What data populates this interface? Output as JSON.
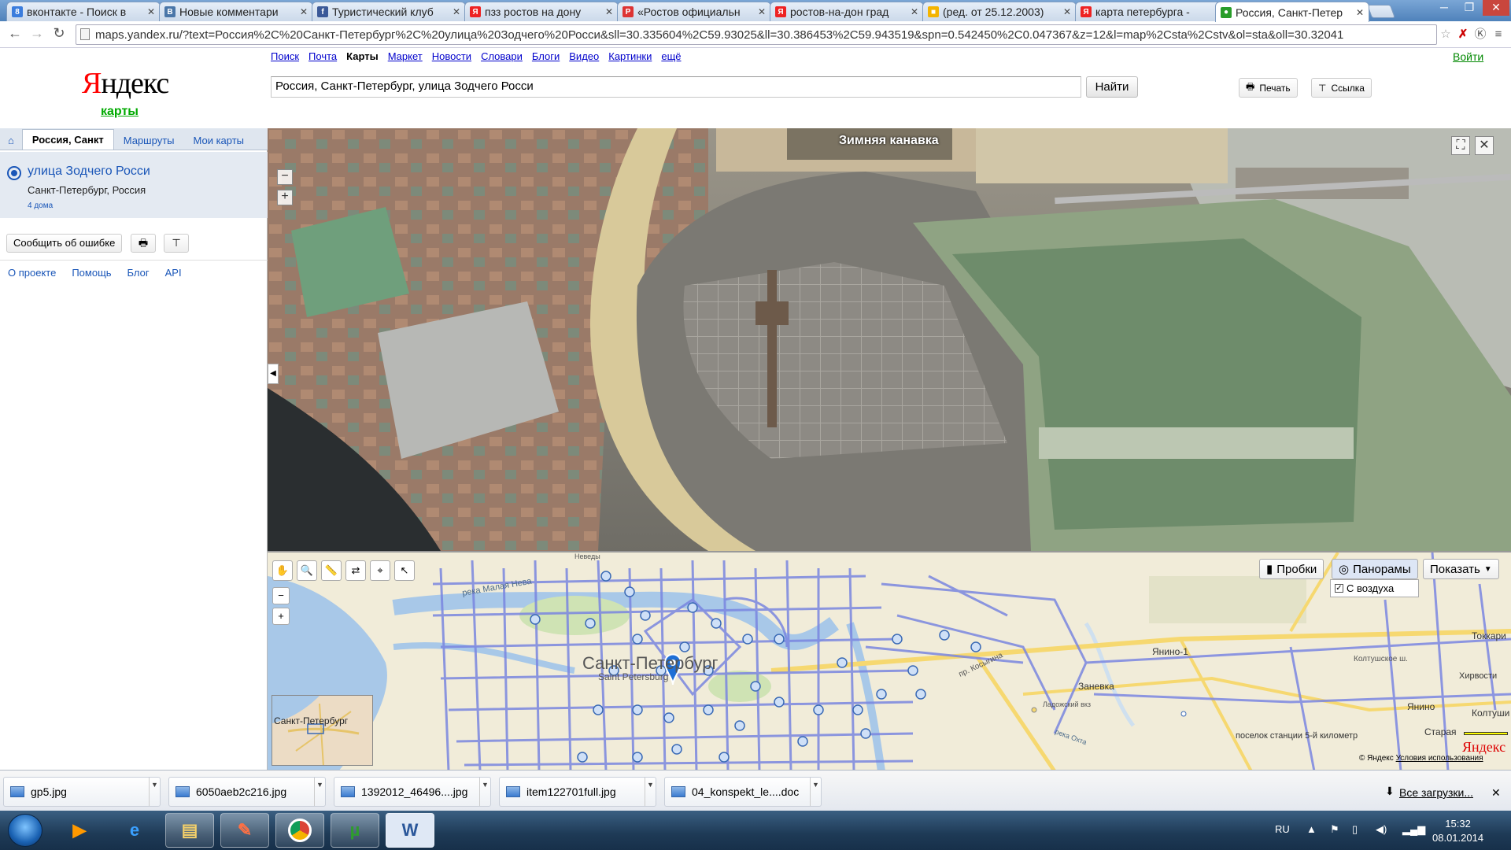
{
  "browser": {
    "tabs": [
      {
        "title": "вконтакте - Поиск в",
        "favicon_color": "#3b7ddd",
        "favicon_letter": "8",
        "active": false
      },
      {
        "title": "Новые комментари",
        "favicon_color": "#4a76a8",
        "favicon_letter": "B",
        "active": false
      },
      {
        "title": "Туристический клуб",
        "favicon_color": "#3b5998",
        "favicon_letter": "f",
        "active": false
      },
      {
        "title": "пзз ростов на дону",
        "favicon_color": "#e22",
        "favicon_letter": "Я",
        "active": false
      },
      {
        "title": "«Ростов официальн",
        "favicon_color": "#d33",
        "favicon_letter": "P",
        "active": false
      },
      {
        "title": "ростов-на-дон град",
        "favicon_color": "#e22",
        "favicon_letter": "Я",
        "active": false
      },
      {
        "title": "(ред. от 25.12.2003)",
        "favicon_color": "#f4b400",
        "favicon_letter": "■",
        "active": false
      },
      {
        "title": "карта петербурга -",
        "favicon_color": "#e22",
        "favicon_letter": "Я",
        "active": false
      },
      {
        "title": "Россия, Санкт-Петер",
        "favicon_color": "#2a9d2a",
        "favicon_letter": "●",
        "active": true
      }
    ],
    "url": "maps.yandex.ru/?text=Россия%2C%20Санкт-Петербург%2C%20улица%20Зодчего%20Росси&sll=30.335604%2C59.93025&ll=30.386453%2C59.943519&spn=0.542450%2C0.047367&z=12&l=map%2Csta%2Cstv&ol=sta&oll=30.32041"
  },
  "header": {
    "logo_first": "Я",
    "logo_rest": "ндекс",
    "logo_sub": "карты",
    "services": [
      "Поиск",
      "Почта",
      "Карты",
      "Маркет",
      "Новости",
      "Словари",
      "Блоги",
      "Видео",
      "Картинки",
      "ещё"
    ],
    "current_service": "Карты",
    "login": "Войти",
    "search_value": "Россия, Санкт-Петербург, улица Зодчего Росси",
    "find_label": "Найти",
    "print_label": "Печать",
    "link_label": "Ссылка"
  },
  "left_panel": {
    "tabs": [
      "Россия, Санкт",
      "Маршруты",
      "Мои карты"
    ],
    "result": {
      "title": "улица Зодчего Росси",
      "subtitle": "Санкт-Петербург, Россия",
      "count": "4 дома"
    },
    "report_error": "Сообщить об ошибке",
    "footer_links": [
      "О проекте",
      "Помощь",
      "Блог",
      "API"
    ]
  },
  "panorama": {
    "title": "Зимняя канавка"
  },
  "map": {
    "buttons": {
      "traffic": "Пробки",
      "panoramas": "Панорамы",
      "show": "Показать"
    },
    "panorama_option": "С воздуха",
    "labels": [
      "Санкт-Петербург",
      "Saint Petersburg",
      "река Малая Нева",
      "Заневка",
      "Янино-1",
      "Токкари",
      "Колтушское ш.",
      "Хирвости",
      "Янино",
      "Колтуши",
      "Старая",
      "поселок станции 5-й километр",
      "Ладожский вкз",
      "пр. Косыгина",
      "река Охта",
      "Неведы"
    ],
    "minimap_label": "Санкт-Петербург",
    "copyright_prefix": "© Яндекс",
    "copyright_link": "Условия использования",
    "watermark": "Яндекс"
  },
  "downloads": {
    "items": [
      "gp5.jpg",
      "6050aeb2c216.jpg",
      "1392012_46496....jpg",
      "item122701full.jpg",
      "04_konspekt_le....doc"
    ],
    "all_label": "Все загрузки..."
  },
  "taskbar": {
    "lang": "RU",
    "time": "15:32",
    "date": "08.01.2014"
  }
}
